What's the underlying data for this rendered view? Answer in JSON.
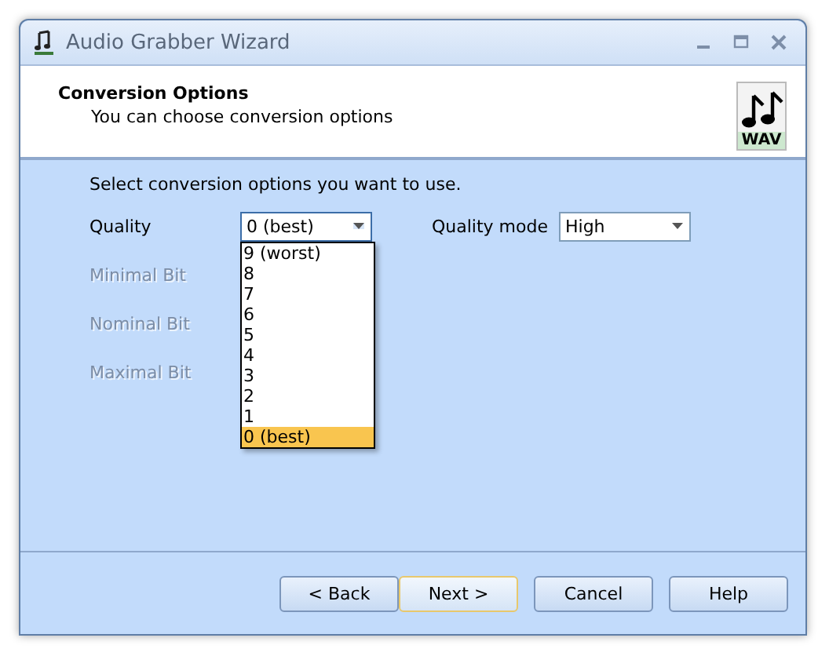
{
  "window": {
    "title": "Audio Grabber Wizard"
  },
  "header": {
    "title": "Conversion Options",
    "subtitle": "You can choose conversion options",
    "badge": "WAV"
  },
  "instruction": "Select conversion options you want to use.",
  "quality": {
    "label": "Quality",
    "value": "0 (best)",
    "expanded": true,
    "options": [
      {
        "label": "9 (worst)",
        "selected": false
      },
      {
        "label": "8",
        "selected": false
      },
      {
        "label": "7",
        "selected": false
      },
      {
        "label": "6",
        "selected": false
      },
      {
        "label": "5",
        "selected": false
      },
      {
        "label": "4",
        "selected": false
      },
      {
        "label": "3",
        "selected": false
      },
      {
        "label": "2",
        "selected": false
      },
      {
        "label": "1",
        "selected": false
      },
      {
        "label": "0 (best)",
        "selected": true
      }
    ]
  },
  "quality_mode": {
    "label": "Quality mode",
    "value": "High"
  },
  "bit_fields": [
    {
      "label": "Minimal Bit",
      "disabled": true
    },
    {
      "label": "Nominal Bit",
      "disabled": true
    },
    {
      "label": "Maximal Bit",
      "disabled": true
    }
  ],
  "buttons": [
    {
      "label": "< Back",
      "focused": false
    },
    {
      "label": "Next >",
      "focused": true
    },
    {
      "label": "Cancel",
      "focused": false
    },
    {
      "label": "Help",
      "focused": false
    }
  ]
}
